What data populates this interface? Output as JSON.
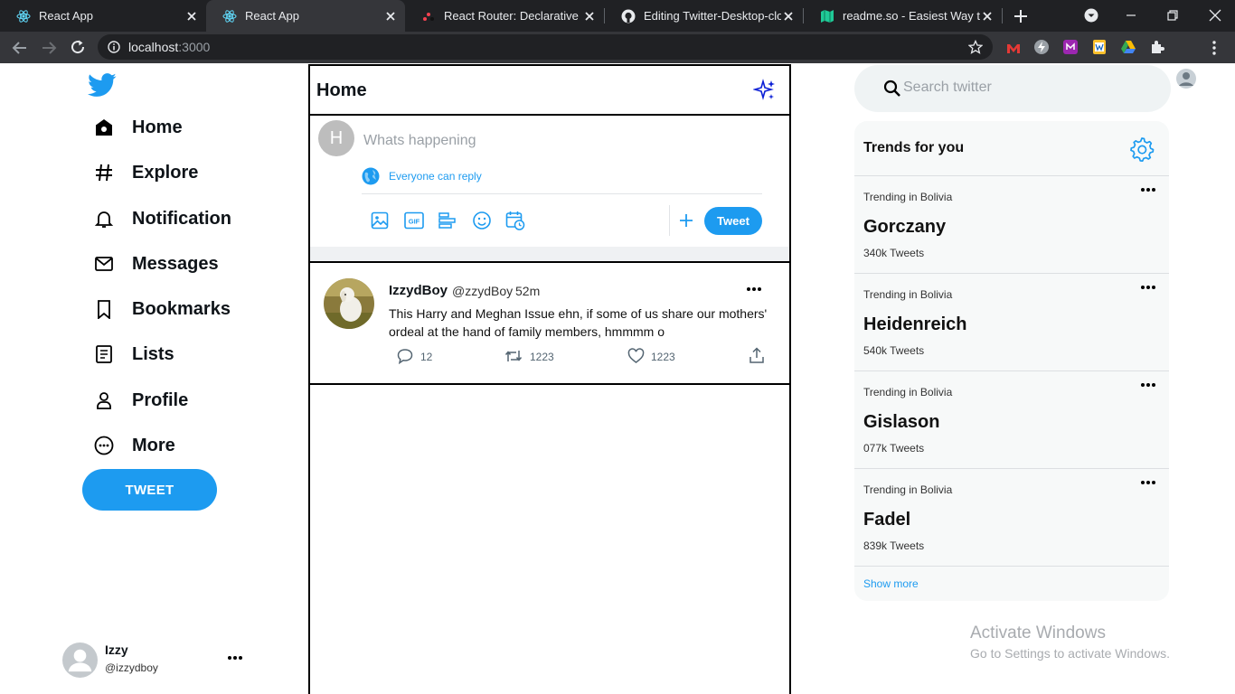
{
  "browser": {
    "tabs": [
      {
        "title": "React App"
      },
      {
        "title": "React App"
      },
      {
        "title": "React Router: Declarative Rou"
      },
      {
        "title": "Editing Twitter-Desktop-clone"
      },
      {
        "title": "readme.so - Easiest Way to C"
      }
    ],
    "url_host": "localhost",
    "url_port": ":3000"
  },
  "sidebar": {
    "items": [
      {
        "label": "Home"
      },
      {
        "label": "Explore"
      },
      {
        "label": "Notification"
      },
      {
        "label": "Messages"
      },
      {
        "label": "Bookmarks"
      },
      {
        "label": "Lists"
      },
      {
        "label": "Profile"
      },
      {
        "label": "More"
      }
    ],
    "tweet_button": "TWEET",
    "user": {
      "name": "Izzy",
      "handle": "@izzydboy"
    }
  },
  "feed": {
    "title": "Home",
    "compose": {
      "avatar_letter": "H",
      "placeholder": "Whats happening",
      "reply_setting": "Everyone can reply",
      "tweet_button": "Tweet"
    },
    "tweet": {
      "name": "IzzydBoy",
      "handle": "@zzydBoy",
      "time": "52m",
      "text": "This Harry and Meghan Issue ehn, if some of us share our mothers' ordeal at the hand of family members, hmmmm o",
      "replies": "12",
      "retweets": "1223",
      "likes": "1223"
    }
  },
  "right": {
    "search_placeholder": "Search twitter",
    "trends_title": "Trends for you",
    "trends": [
      {
        "location": "Trending in Bolivia",
        "name": "Gorczany",
        "count": "340k Tweets"
      },
      {
        "location": "Trending in Bolivia",
        "name": "Heidenreich",
        "count": "540k Tweets"
      },
      {
        "location": "Trending in Bolivia",
        "name": "Gislason",
        "count": "077k Tweets"
      },
      {
        "location": "Trending in Bolivia",
        "name": "Fadel",
        "count": "839k Tweets"
      }
    ],
    "show_more": "Show more"
  },
  "watermark": {
    "title": "Activate Windows",
    "subtitle": "Go to Settings to activate Windows."
  },
  "colors": {
    "accent": "#1d9bf0",
    "chrome_dark": "#202124",
    "chrome_mid": "#35363a"
  }
}
